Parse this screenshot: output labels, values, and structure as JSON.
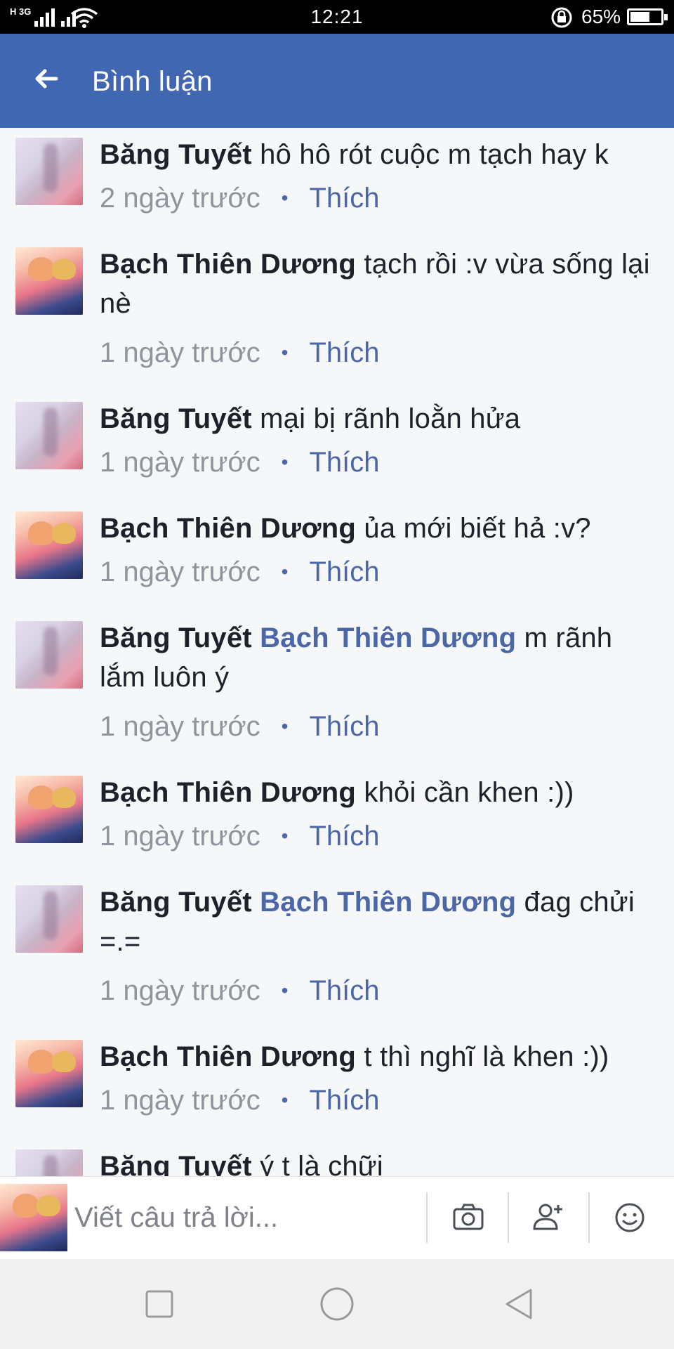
{
  "status_bar": {
    "network": "H 3G",
    "time": "12:21",
    "battery_pct": "65%",
    "battery_level": 0.65,
    "icons": [
      "signal-icon",
      "wifi-icon",
      "rotation-lock-icon",
      "battery-icon"
    ]
  },
  "header": {
    "title": "Bình luận",
    "back_icon": "arrow-left-icon",
    "bg_color": "#4267b2"
  },
  "comments": [
    {
      "author": "Băng Tuyết",
      "mention": "",
      "text": "hô hô rót cuộc m tạch hay k",
      "time": "2 ngày trước",
      "like": "Thích",
      "avatar": "tuyet"
    },
    {
      "author": "Bạch Thiên Dương",
      "mention": "",
      "text": "tạch rồi :v vừa sống lại nè",
      "time": "1 ngày trước",
      "like": "Thích",
      "avatar": "duong"
    },
    {
      "author": "Băng Tuyết",
      "mention": "",
      "text": "mại bị rãnh loằn hửa",
      "time": "1 ngày trước",
      "like": "Thích",
      "avatar": "tuyet"
    },
    {
      "author": "Bạch Thiên Dương",
      "mention": "",
      "text": "ủa mới biết hả :v?",
      "time": "1 ngày trước",
      "like": "Thích",
      "avatar": "duong"
    },
    {
      "author": "Băng Tuyết",
      "mention": "Bạch Thiên Dương",
      "text": "m rãnh lắm luôn ý",
      "time": "1 ngày trước",
      "like": "Thích",
      "avatar": "tuyet"
    },
    {
      "author": "Bạch Thiên Dương",
      "mention": "",
      "text": "khỏi cần khen :))",
      "time": "1 ngày trước",
      "like": "Thích",
      "avatar": "duong"
    },
    {
      "author": "Băng Tuyết",
      "mention": "Bạch Thiên Dương",
      "text": "đag chửi =.=",
      "time": "1 ngày trước",
      "like": "Thích",
      "avatar": "tuyet"
    },
    {
      "author": "Bạch Thiên Dương",
      "mention": "",
      "text": "t thì nghĩ là khen :))",
      "time": "1 ngày trước",
      "like": "Thích",
      "avatar": "duong"
    },
    {
      "author": "Băng Tuyết",
      "mention": "",
      "text": "ý t là chữi",
      "time": "",
      "like": "",
      "avatar": "tuyet"
    }
  ],
  "compose": {
    "placeholder": "Viết câu trả lời...",
    "value": "",
    "icons": [
      "camera-icon",
      "tag-friend-icon",
      "emoji-icon"
    ]
  },
  "navbar": {
    "icons": [
      "recent-apps-icon",
      "home-icon",
      "back-icon"
    ]
  },
  "colors": {
    "accent": "#4267b2",
    "link": "#4b67a8",
    "muted": "#90949c",
    "text": "#1d2129"
  }
}
